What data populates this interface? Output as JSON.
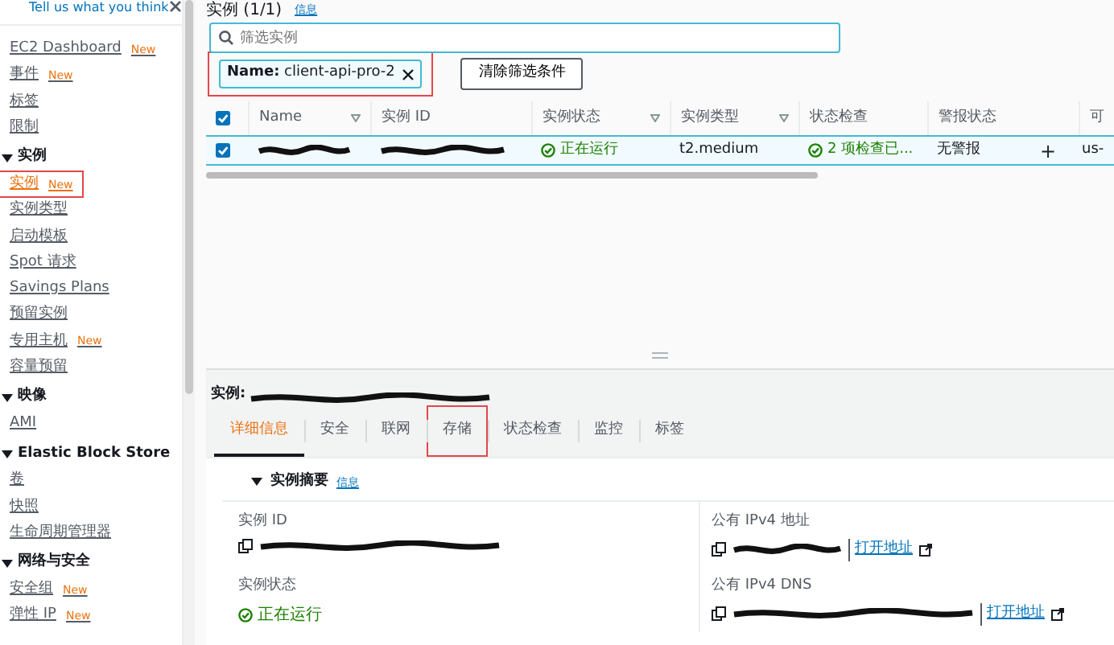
{
  "feedback": {
    "text": "Tell us what you think"
  },
  "sidebar": {
    "items": [
      {
        "label": "EC2 Dashboard",
        "badge": "New",
        "selected": false,
        "highlighted": false
      },
      {
        "label": "事件",
        "badge": "New",
        "selected": false,
        "highlighted": false
      },
      {
        "label": "标签",
        "selected": false,
        "highlighted": false
      },
      {
        "label": "限制",
        "selected": false,
        "highlighted": false
      },
      {
        "label": "实例",
        "expanded": true,
        "children": [
          {
            "label": "实例",
            "badge": "New",
            "selected": true,
            "highlighted": true
          },
          {
            "label": "实例类型",
            "selected": false,
            "highlighted": false
          },
          {
            "label": "启动模板",
            "selected": false,
            "highlighted": false
          },
          {
            "label": "Spot 请求",
            "selected": false,
            "highlighted": false
          },
          {
            "label": "Savings Plans",
            "selected": false,
            "highlighted": false
          },
          {
            "label": "预留实例",
            "selected": false,
            "highlighted": false
          },
          {
            "label": "专用主机",
            "badge": "New",
            "selected": false,
            "highlighted": false
          },
          {
            "label": "容量预留",
            "selected": false,
            "highlighted": false
          }
        ]
      },
      {
        "label": "映像",
        "expanded": true,
        "children": [
          {
            "label": "AMI",
            "selected": false,
            "highlighted": false
          }
        ]
      },
      {
        "label": "Elastic Block Store",
        "expanded": true,
        "children": [
          {
            "label": "卷",
            "selected": false,
            "highlighted": false
          },
          {
            "label": "快照",
            "selected": false,
            "highlighted": false
          },
          {
            "label": "生命周期管理器",
            "selected": false,
            "highlighted": false
          }
        ]
      },
      {
        "label": "网络与安全",
        "expanded": true,
        "children": [
          {
            "label": "安全组",
            "badge": "New",
            "selected": false,
            "highlighted": false
          },
          {
            "label": "弹性 IP",
            "badge": "New",
            "selected": false,
            "highlighted": false
          }
        ]
      }
    ]
  },
  "instances": {
    "title": "实例 (1/1)",
    "info": "信息",
    "search": {
      "placeholder": "筛选实例"
    },
    "filter": {
      "text": "**Name:** client-api-pro-2",
      "highlighted": true
    },
    "clear_button": "清除筛选条件",
    "table": {
      "header_checked": true,
      "columns": [
        {
          "label": "Name",
          "sortable": true
        },
        {
          "label": "实例 ID"
        },
        {
          "label": "实例状态",
          "sortable": true
        },
        {
          "label": "实例类型",
          "sortable": true
        },
        {
          "label": "状态检查"
        },
        {
          "label": "警报状态"
        },
        {
          "kind": "blank"
        },
        {
          "label": "可"
        }
      ],
      "rows": [
        {
          "selected": true,
          "checked": true,
          "cells": [
            {
              "kind": "redacted"
            },
            {
              "kind": "redacted"
            },
            {
              "kind": "status",
              "text": "正在运行"
            },
            {
              "kind": "text",
              "text": "t2.medium"
            },
            {
              "kind": "status",
              "text": "2 项检查已..."
            },
            {
              "kind": "text",
              "text": "无警报"
            },
            {
              "kind": "action",
              "text": "+"
            },
            {
              "kind": "text",
              "text": "us-"
            }
          ]
        }
      ]
    }
  },
  "details": {
    "title": "实例:",
    "tabs": [
      {
        "label": "详细信息",
        "selected": true,
        "highlighted": false
      },
      {
        "label": "安全",
        "selected": false,
        "highlighted": false
      },
      {
        "label": "联网",
        "selected": false,
        "highlighted": false
      },
      {
        "label": "存储",
        "selected": false,
        "highlighted": true
      },
      {
        "label": "状态检查",
        "selected": false,
        "highlighted": false
      },
      {
        "label": "监控",
        "selected": false,
        "highlighted": false
      },
      {
        "label": "标签",
        "selected": false,
        "highlighted": false
      }
    ],
    "section": {
      "title": "实例摘要",
      "info": "信息",
      "expanded": true
    },
    "fields": [
      {
        "label": "实例 ID",
        "kind": "copy"
      },
      {
        "label": "公有 IPv4 地址",
        "kind": "copy",
        "link": "打开地址"
      },
      {
        "label": "实例状态",
        "kind": "status",
        "text": "正在运行"
      },
      {
        "label": "公有 IPv4 DNS",
        "kind": "copy",
        "link": "打开地址"
      }
    ]
  }
}
